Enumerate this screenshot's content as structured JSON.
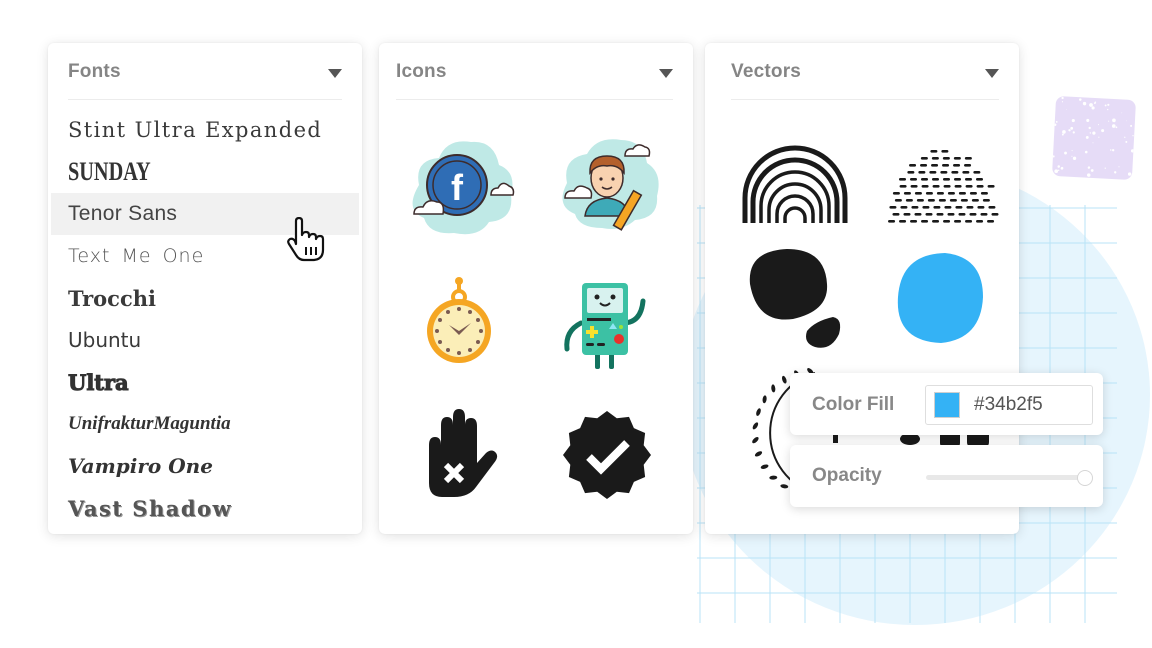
{
  "background": {
    "circle_color": "#e6f5fd",
    "grid_color": "#b8e3f7",
    "square_color": "#e6dcf7"
  },
  "fonts_panel": {
    "title": "Fonts",
    "items": [
      {
        "label": "Stint Ultra Expanded",
        "hovered": false
      },
      {
        "label": "SUNDAY",
        "hovered": false
      },
      {
        "label": "Tenor Sans",
        "hovered": true
      },
      {
        "label": "Text Me One",
        "hovered": false
      },
      {
        "label": "Trocchi",
        "hovered": false
      },
      {
        "label": "Ubuntu",
        "hovered": false
      },
      {
        "label": "Ultra",
        "hovered": false
      },
      {
        "label": "UnifrakturMaguntia",
        "hovered": false
      },
      {
        "label": "Vampiro One",
        "hovered": false
      },
      {
        "label": "Vast Shadow",
        "hovered": false
      }
    ]
  },
  "icons_panel": {
    "title": "Icons",
    "items": [
      {
        "name": "facebook-cloud-icon",
        "letter": "f"
      },
      {
        "name": "user-edit-cloud-icon"
      },
      {
        "name": "pocket-watch-icon"
      },
      {
        "name": "bmo-robot-icon"
      },
      {
        "name": "hand-stop-x-icon"
      },
      {
        "name": "verified-badge-icon"
      }
    ]
  },
  "vectors_panel": {
    "title": "Vectors",
    "items": [
      {
        "name": "rainbow-arches-vector"
      },
      {
        "name": "dashed-dome-vector"
      },
      {
        "name": "black-blob-vector",
        "color": "#1a1a1a"
      },
      {
        "name": "blue-blob-vector",
        "color": "#34b2f5"
      },
      {
        "name": "laurel-wreath-vector"
      },
      {
        "name": "partial-shapes-vector"
      }
    ]
  },
  "properties": {
    "color_fill_label": "Color Fill",
    "color_value": "#34b2f5",
    "opacity_label": "Opacity",
    "opacity_value": 1.0
  }
}
